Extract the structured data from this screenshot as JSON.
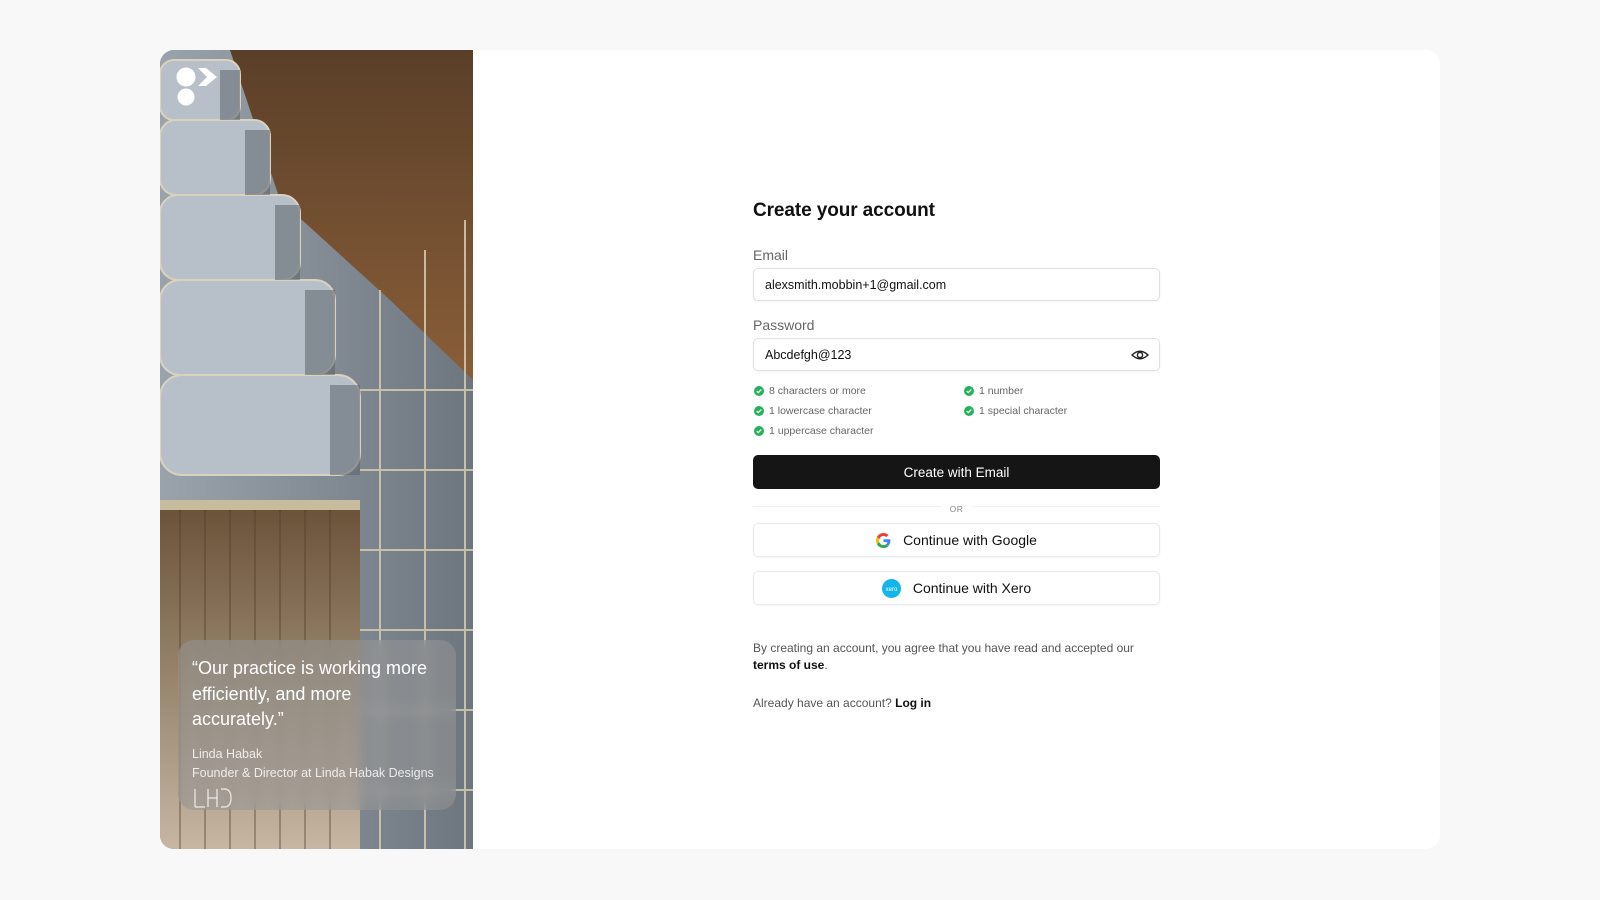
{
  "form": {
    "title": "Create your account",
    "email_label": "Email",
    "email_value": "alexsmith.mobbin+1@gmail.com",
    "password_label": "Password",
    "password_value": "Abcdefgh@123",
    "password_rules": [
      {
        "text": "8 characters or more",
        "met": true
      },
      {
        "text": "1 number",
        "met": true
      },
      {
        "text": "1 lowercase character",
        "met": true
      },
      {
        "text": "1 special character",
        "met": true
      },
      {
        "text": "1 uppercase character",
        "met": true
      }
    ],
    "primary_button": "Create with Email",
    "divider": "OR",
    "google_button": "Continue with Google",
    "xero_button": "Continue with Xero",
    "xero_icon_text": "xero",
    "legal_text": "By creating an account, you agree that you have read and accepted our",
    "legal_link": "terms of use",
    "legal_end": ".",
    "login_prompt": "Already have an account?",
    "login_link": "Log in"
  },
  "testimonial": {
    "quote": "“Our practice is working more efficiently, and more accurately.”",
    "name": "Linda Habak",
    "role": "Founder & Director at Linda Habak Designs",
    "mark": "LHD"
  },
  "colors": {
    "primary": "#151515",
    "check": "#22b35a",
    "xero": "#13b5ea"
  },
  "icons": {
    "logo": "brand-logo-icon",
    "eye": "eye-icon",
    "check": "check-circle-icon",
    "google": "google-icon",
    "xero": "xero-icon"
  }
}
